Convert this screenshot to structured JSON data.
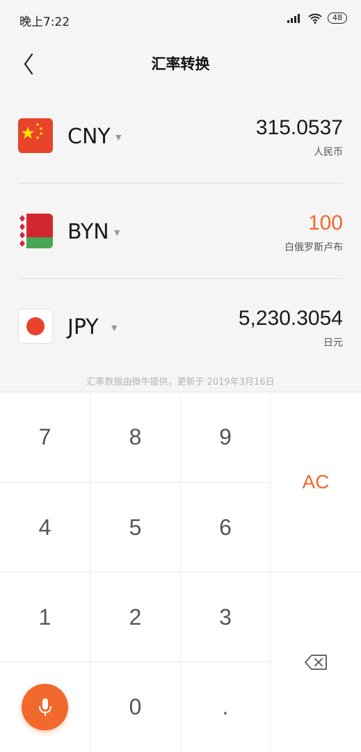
{
  "status_bar": {
    "time": "晚上7:22",
    "battery": "48"
  },
  "header": {
    "title": "汇率转换"
  },
  "currencies": [
    {
      "code": "CNY",
      "amount": "315.0537",
      "name": "人民币",
      "active": false
    },
    {
      "code": "BYN",
      "amount": "100",
      "name": "白俄罗斯卢布",
      "active": true
    },
    {
      "code": "JPY",
      "amount": "5,230.3054",
      "name": "日元",
      "active": false
    }
  ],
  "note": "汇率数据由微牛提供，更新于 2019年3月16日",
  "keypad": {
    "k7": "7",
    "k8": "8",
    "k9": "9",
    "k4": "4",
    "k5": "5",
    "k6": "6",
    "k1": "1",
    "k2": "2",
    "k3": "3",
    "k0": "0",
    "kdot": ".",
    "clear": "AC"
  },
  "colors": {
    "accent": "#f2692e",
    "background": "#f5f5f5"
  }
}
